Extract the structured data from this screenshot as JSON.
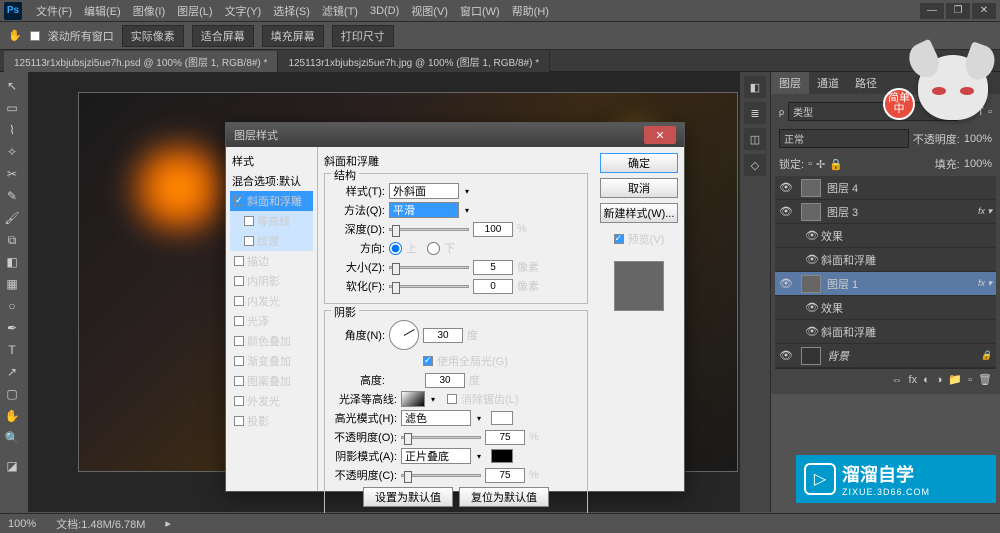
{
  "menu": {
    "items": [
      "文件(F)",
      "编辑(E)",
      "图像(I)",
      "图层(L)",
      "文字(Y)",
      "选择(S)",
      "滤镜(T)",
      "3D(D)",
      "视图(V)",
      "窗口(W)",
      "帮助(H)"
    ]
  },
  "options": {
    "scroll_all": "滚动所有窗口",
    "actual": "实际像素",
    "fit": "适合屏幕",
    "fill": "填充屏幕",
    "print": "打印尺寸"
  },
  "tabs": [
    {
      "label": "125113r1xbjubsjzi5ue7h.psd @ 100% (图层 1, RGB/8#) *"
    },
    {
      "label": "125113r1xbjubsjzi5ue7h.jpg @ 100% (图层 1, RGB/8#) *"
    }
  ],
  "dialog": {
    "title": "图层样式",
    "sidebar": {
      "styles": "样式",
      "blend": "混合选项:默认",
      "items": [
        "斜面和浮雕",
        "等高线",
        "纹理",
        "描边",
        "内阴影",
        "内发光",
        "光泽",
        "颜色叠加",
        "渐变叠加",
        "图案叠加",
        "外发光",
        "投影"
      ],
      "checked": [
        0,
        1,
        2
      ]
    },
    "section_title": "斜面和浮雕",
    "structure": {
      "title": "结构",
      "style_l": "样式(T):",
      "style_v": "外斜面",
      "method_l": "方法(Q):",
      "method_v": "平滑",
      "depth_l": "深度(D):",
      "depth_v": "100",
      "depth_u": "%",
      "dir_l": "方向:",
      "dir_up": "上",
      "dir_down": "下",
      "size_l": "大小(Z):",
      "size_v": "5",
      "size_u": "像素",
      "soft_l": "软化(F):",
      "soft_v": "0",
      "soft_u": "像素"
    },
    "shading": {
      "title": "阴影",
      "angle_l": "角度(N):",
      "angle_v": "30",
      "deg": "度",
      "global": "使用全局光(G)",
      "alt_l": "高度:",
      "alt_v": "30",
      "gloss_l": "光泽等高线:",
      "anti": "消除锯齿(L)",
      "hmode_l": "高光模式(H):",
      "hmode_v": "滤色",
      "hopac_l": "不透明度(O):",
      "hopac_v": "75",
      "smode_l": "阴影模式(A):",
      "smode_v": "正片叠底",
      "sopac_l": "不透明度(C):",
      "sopac_v": "75",
      "pct": "%"
    },
    "btns": {
      "ok": "确定",
      "cancel": "取消",
      "new": "新建样式(W)...",
      "preview": "预览(V)",
      "default1": "设置为默认值",
      "default2": "复位为默认值"
    }
  },
  "panels": {
    "tabs": [
      "图层",
      "通道",
      "路径"
    ],
    "kind": "类型",
    "mode": "正常",
    "opacity_l": "不透明度:",
    "opacity_v": "100%",
    "lock": "锁定:",
    "fill_l": "填充:",
    "fill_v": "100%",
    "layers": [
      {
        "name": "图层 4"
      },
      {
        "name": "图层 3",
        "fx": true
      },
      {
        "name": "效果",
        "sub": true
      },
      {
        "name": "斜面和浮雕",
        "sub": true
      },
      {
        "name": "图层 1",
        "fx": true,
        "sel": true
      },
      {
        "name": "效果",
        "sub": true
      },
      {
        "name": "斜面和浮雕",
        "sub": true
      },
      {
        "name": "背景",
        "locked": true
      }
    ],
    "side_labels": {
      "styles": "样式",
      "layers": "图层",
      "channels": "通道",
      "paths": "路径"
    }
  },
  "status": {
    "zoom": "100%",
    "doc": "文档:1.48M/6.78M"
  },
  "mascot": {
    "badge": "简单中"
  },
  "watermark": {
    "brand": "溜溜自学",
    "url": "ZIXUE.3D66.COM"
  }
}
